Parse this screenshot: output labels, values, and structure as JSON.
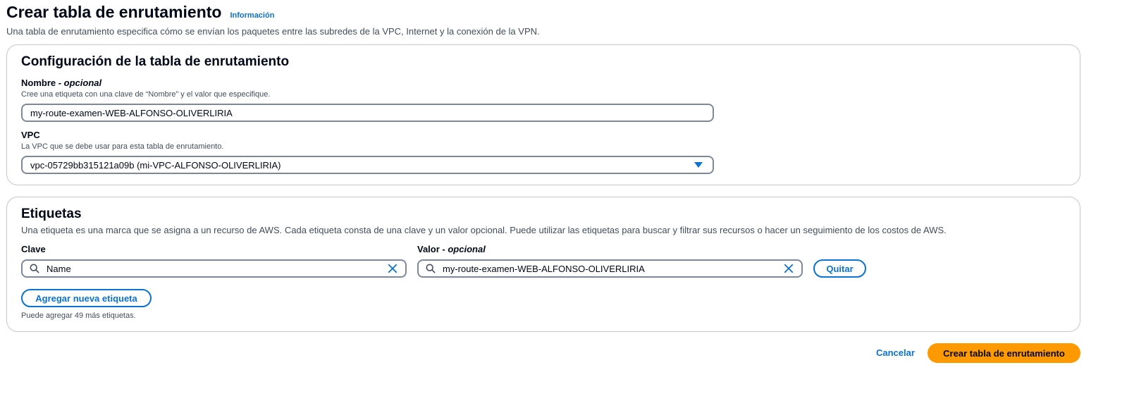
{
  "header": {
    "title": "Crear tabla de enrutamiento",
    "info_link": "Información",
    "description": "Una tabla de enrutamiento especifica cómo se envían los paquetes entre las subredes de la VPC, Internet y la conexión de la VPN."
  },
  "config": {
    "title": "Configuración de la tabla de enrutamiento",
    "name_label": "Nombre - ",
    "name_label_optional": "opcional",
    "name_help": "Cree una etiqueta con una clave de “Nombre” y el valor que especifique.",
    "name_value": "my-route-examen-WEB-ALFONSO-OLIVERLIRIA",
    "vpc_label": "VPC",
    "vpc_help": "La VPC que se debe usar para esta tabla de enrutamiento.",
    "vpc_selected": "vpc-05729bb315121a09b (mi-VPC-ALFONSO-OLIVERLIRIA)"
  },
  "tags": {
    "title": "Etiquetas",
    "description": "Una etiqueta es una marca que se asigna a un recurso de AWS. Cada etiqueta consta de una clave y un valor opcional. Puede utilizar las etiquetas para buscar y filtrar sus recursos o hacer un seguimiento de los costos de AWS.",
    "key_label": "Clave",
    "value_label": "Valor - ",
    "value_label_optional": "opcional",
    "rows": [
      {
        "key": "Name",
        "value": "my-route-examen-WEB-ALFONSO-OLIVERLIRIA"
      }
    ],
    "remove_label": "Quitar",
    "add_label": "Agregar nueva etiqueta",
    "limit_text": "Puede agregar 49 más etiquetas."
  },
  "footer": {
    "cancel_label": "Cancelar",
    "submit_label": "Crear tabla de enrutamiento"
  },
  "colors": {
    "accent": "#0972d3",
    "primary_button": "#ff9900",
    "border": "#c6c6cd",
    "input_border": "#7d8998"
  },
  "icons": [
    "search-icon",
    "clear-icon",
    "caret-down-icon"
  ]
}
